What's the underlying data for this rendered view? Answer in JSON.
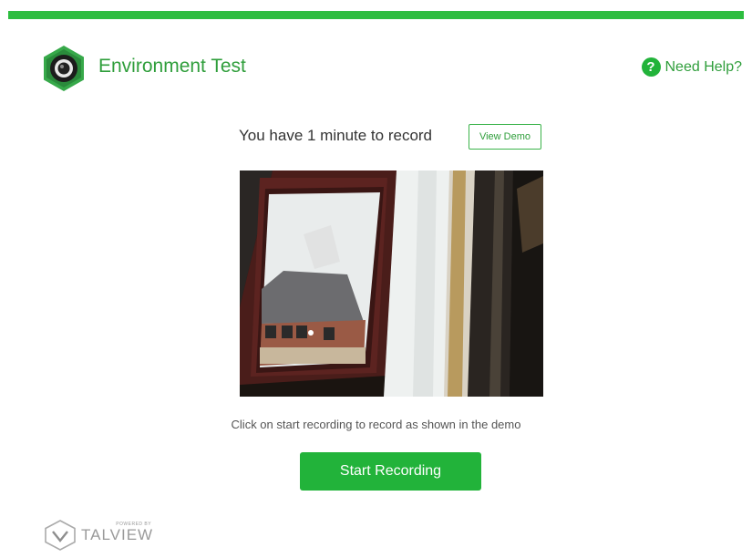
{
  "header": {
    "app_title": "Environment Test",
    "help_label": "Need Help?",
    "help_icon_glyph": "?",
    "accent_color": "#2dbd3f"
  },
  "main": {
    "record_prompt": "You have 1 minute to record",
    "view_demo_label": "View Demo",
    "instruction": "Click on start recording to record as shown in the demo",
    "start_label": "Start Recording"
  },
  "footer": {
    "powered_by": "POWERED BY",
    "brand": "TALVIEW"
  },
  "icons": {
    "logo": "camera-lens-hexagon-icon",
    "help": "question-circle-icon",
    "brand": "talview-logo-icon"
  }
}
